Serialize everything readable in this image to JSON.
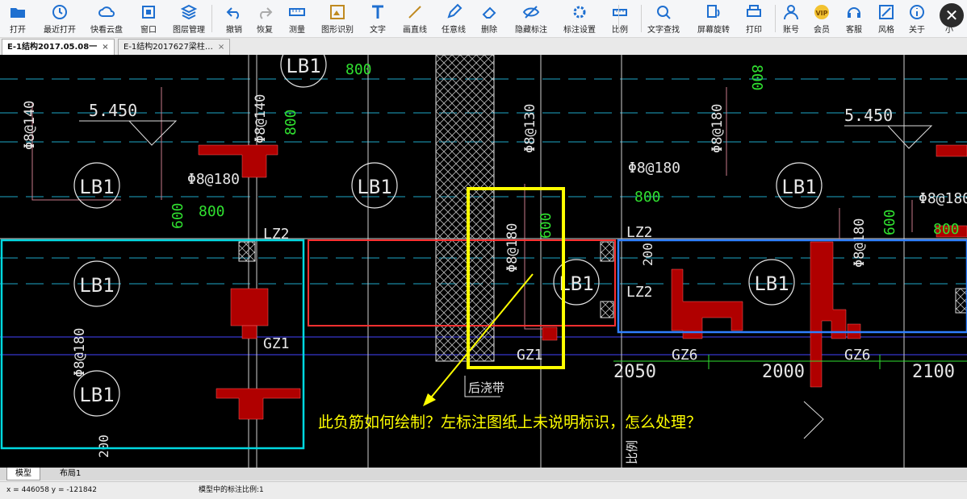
{
  "toolbar": {
    "items": [
      {
        "label": "打开",
        "icon": "folder-open-icon"
      },
      {
        "label": "最近打开",
        "icon": "clock-icon"
      },
      {
        "label": "快看云盘",
        "icon": "cloud-icon"
      },
      {
        "label": "窗口",
        "icon": "window-icon"
      },
      {
        "label": "图层管理",
        "icon": "layers-icon"
      },
      {
        "label": "撤销",
        "icon": "undo-icon"
      },
      {
        "label": "恢复",
        "icon": "redo-icon"
      },
      {
        "label": "测量",
        "icon": "ruler-icon"
      },
      {
        "label": "图形识别",
        "icon": "shape-recognize-icon"
      },
      {
        "label": "文字",
        "icon": "text-icon"
      },
      {
        "label": "画直线",
        "icon": "line-icon"
      },
      {
        "label": "任意线",
        "icon": "pencil-icon"
      },
      {
        "label": "删除",
        "icon": "eraser-icon"
      },
      {
        "label": "隐藏标注",
        "icon": "eye-hidden-icon"
      },
      {
        "label": "标注设置",
        "icon": "annotation-settings-icon"
      },
      {
        "label": "比例",
        "icon": "scale-icon"
      },
      {
        "label": "文字查找",
        "icon": "text-search-icon"
      },
      {
        "label": "屏幕旋转",
        "icon": "rotate-screen-icon"
      },
      {
        "label": "打印",
        "icon": "printer-icon"
      },
      {
        "label": "账号",
        "icon": "user-icon"
      },
      {
        "label": "会员",
        "icon": "vip-icon"
      },
      {
        "label": "客服",
        "icon": "headset-icon"
      },
      {
        "label": "风格",
        "icon": "style-icon"
      },
      {
        "label": "关于",
        "icon": "info-icon"
      },
      {
        "label": "小",
        "icon": "minimize-icon"
      }
    ],
    "close_glyph": "✕"
  },
  "tabs": [
    {
      "label": "E-1结构2017.05.08一",
      "active": true
    },
    {
      "label": "E-1结构2017627梁柱…",
      "active": false
    }
  ],
  "tab_close_glyph": "×",
  "drawing": {
    "labels_lb1": [
      "LB1",
      "LB1",
      "LB1",
      "LB1",
      "LB1",
      "LB1",
      "LB1",
      "LB1",
      "LB1"
    ],
    "rebar": [
      "Φ8@140",
      "Φ8@140",
      "Φ8@130",
      "Φ8@180",
      "Φ8@180",
      "Φ8@180",
      "Φ8@180",
      "Φ8@180",
      "Φ8@180",
      "Φ8@180"
    ],
    "dims": [
      "800",
      "800",
      "800",
      "800",
      "800",
      "800",
      "600",
      "600",
      "600",
      "200",
      "200",
      "2050",
      "2000",
      "2100"
    ],
    "elevations": [
      "5.450",
      "5.450"
    ],
    "columns": [
      "LZ2",
      "LZ2",
      "LZ2",
      "GZ1",
      "GZ1",
      "GZ6",
      "GZ6"
    ],
    "post_pour": "后浇带",
    "question": "此负筋如何绘制？左标注图纸上未说明标识，怎么处理？",
    "ratio_text": "比例"
  },
  "bottom_tabs": [
    "模型",
    "布局1"
  ],
  "status": {
    "coords": "x = 446058  y = -121842",
    "scale": "模型中的标注比例:1"
  },
  "colors": {
    "cyan": "#00d8e0",
    "red": "#ff3030",
    "yellow": "#ffff00",
    "blue": "#2f80ff",
    "beam": "#b00000",
    "green": "#30e030",
    "text": "#e6e6e6"
  }
}
